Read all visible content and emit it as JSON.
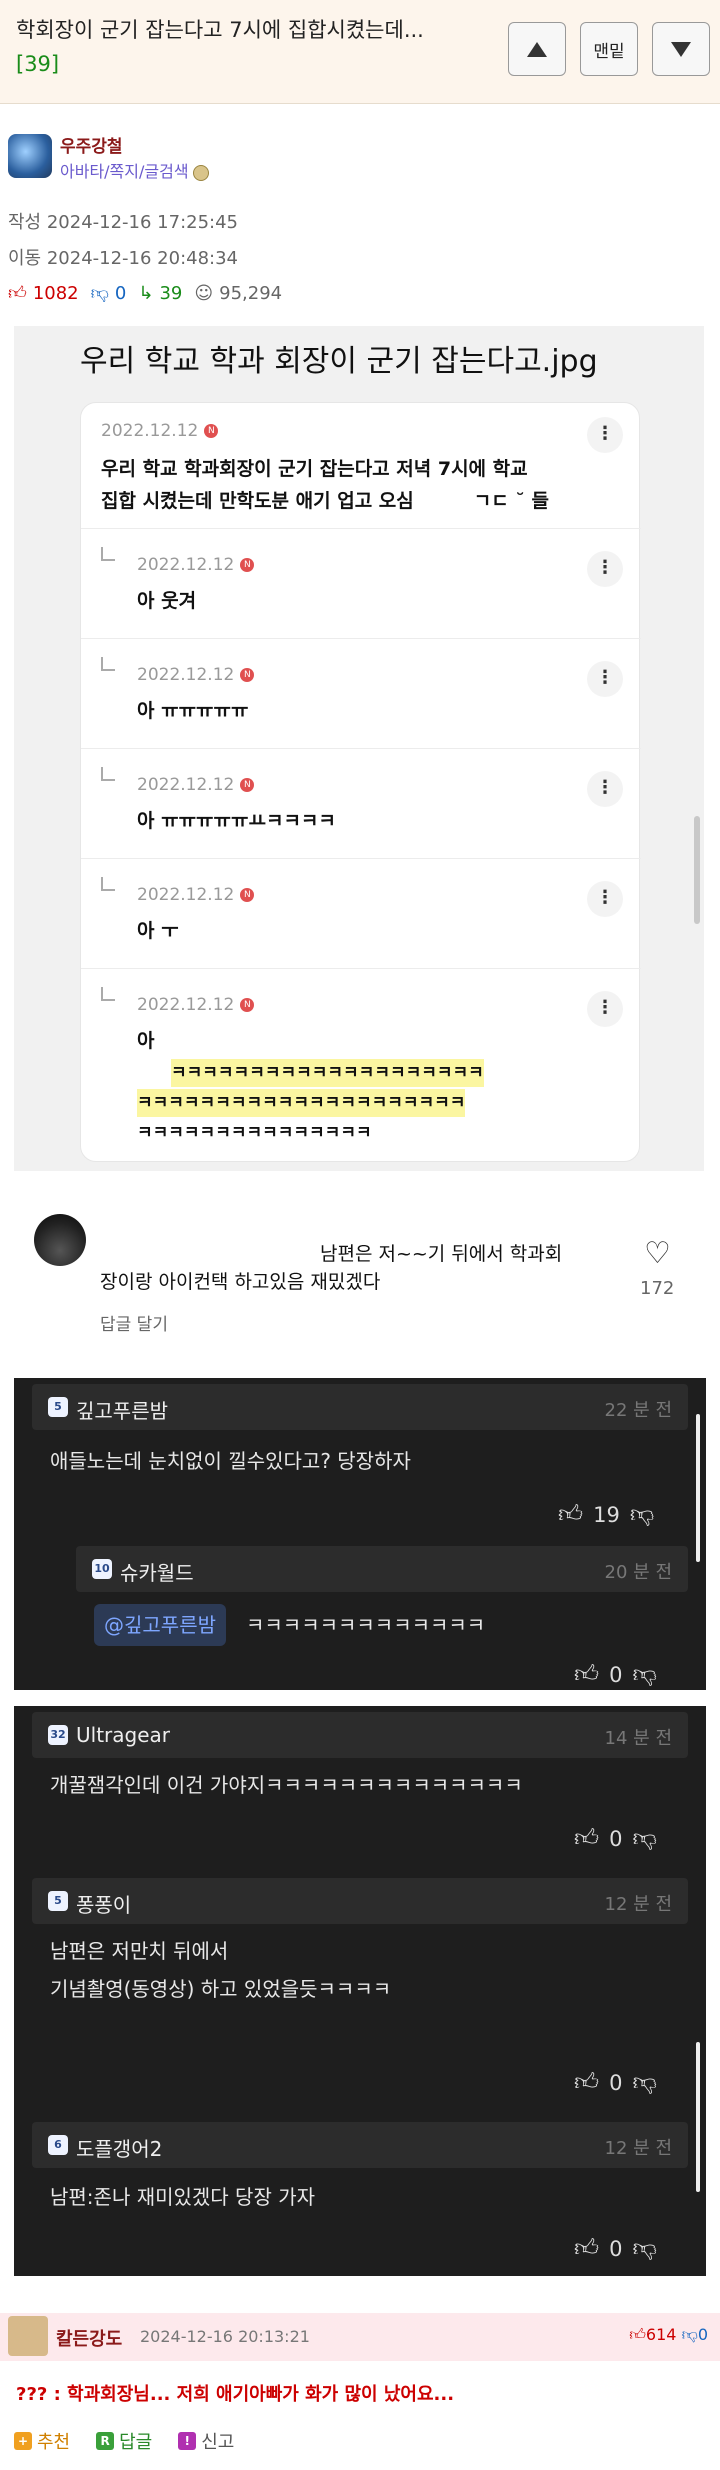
{
  "header": {
    "title": "학회장이 군기 잡는다고 7시에 집합시켰는데...",
    "comment_count": "[39]",
    "up_label": "",
    "top_label": "맨밑",
    "down_label": ""
  },
  "author": {
    "name": "우주강철",
    "links": "아바타/쪽지/글검색"
  },
  "post_meta": {
    "written": "작성 2024-12-16 17:25:45",
    "moved": "이동 2024-12-16 20:48:34"
  },
  "stats": {
    "up": "1082",
    "down": "0",
    "replies": "39",
    "views": "95,294"
  },
  "embedded": {
    "title": "우리 학교 학과 회장이 군기 잡는다고.jpg",
    "main_date": "2022.12.12",
    "main_text_1": "우리 학교 학과회장이 군기 잡는다고 저녁 7시에 학교",
    "main_text_2": "집합 시켰는데 만학도분 애기 업고 오심",
    "main_text_tail": "ㄱㄷ ˘ 들",
    "replies": [
      {
        "date": "2022.12.12",
        "text": "아          웃겨"
      },
      {
        "date": "2022.12.12",
        "text": "아 ㅠㅠㅠㅠㅠ"
      },
      {
        "date": "2022.12.12",
        "text": "아       ㅠㅠㅠㅠㅠㅛㅋㅋㅋㅋ"
      },
      {
        "date": "2022.12.12",
        "text": "아       ㅜ"
      },
      {
        "date": "2022.12.12",
        "text": "아"
      }
    ],
    "long_laugh_1": "ㅋㅋㅋㅋㅋㅋㅋㅋㅋㅋㅋㅋㅋㅋㅋㅋㅋㅋㅋㅋ",
    "long_laugh_2": "ㅋㅋㅋㅋㅋㅋㅋㅋㅋㅋㅋㅋㅋㅋㅋㅋㅋㅋㅋㅋㅋ",
    "long_laugh_3": "ㅋㅋㅋㅋㅋㅋㅋㅋㅋㅋㅋㅋㅋㅋㅋ"
  },
  "embedded_comment": {
    "text_1": "남편은 저~~기 뒤에서 학과회",
    "text_2": "장이랑 아이컨택 하고있음 재밌겠다",
    "likes": "172",
    "reply_link": "답글 달기"
  },
  "dark_block_1": [
    {
      "badge": "5",
      "name": "깊고푸른밤",
      "time": "22 분 전",
      "text": "애들노는데 눈치없이 낄수있다고? 당장하자",
      "likes": "19"
    },
    {
      "badge": "10",
      "name": "슈카월드",
      "time": "20 분 전",
      "mention": "@깊고푸른밤",
      "text": "ㅋㅋㅋㅋㅋㅋㅋㅋㅋㅋㅋㅋㅋ",
      "likes": "0"
    }
  ],
  "dark_block_2": [
    {
      "badge": "32",
      "name": "Ultragear",
      "time": "14 분 전",
      "text": "개꿀잼각인데 이건 가야지ㅋㅋㅋㅋㅋㅋㅋㅋㅋㅋㅋㅋㅋㅋ",
      "likes": "0"
    },
    {
      "badge": "5",
      "name": "퐁퐁이",
      "time": "12 분 전",
      "text_1": "남편은 저만치 뒤에서",
      "text_2": "기념촬영(동영상) 하고 있었을듯ㅋㅋㅋㅋ",
      "likes": "0"
    },
    {
      "badge": "6",
      "name": "도플갱어2",
      "time": "12 분 전",
      "text": "남편:존나 재미있겠다 당장 가자",
      "likes": "0"
    }
  ],
  "last_comment": {
    "name": "칼든강도",
    "date": "2024-12-16 20:13:21",
    "up": "614",
    "down": "0",
    "text": "??? : 학과회장님... 저희 애기아빠가 화가 많이 났어요...",
    "recommend": "추천",
    "reply": "답글",
    "report": "신고"
  },
  "colors": {
    "header_bg": "#fdf5ec",
    "count_green": "#1a8c1a",
    "up_red": "#cc0000",
    "down_blue": "#1565c0",
    "dark_bg": "#1e1e1e",
    "highlight": "#fbf6a1"
  }
}
